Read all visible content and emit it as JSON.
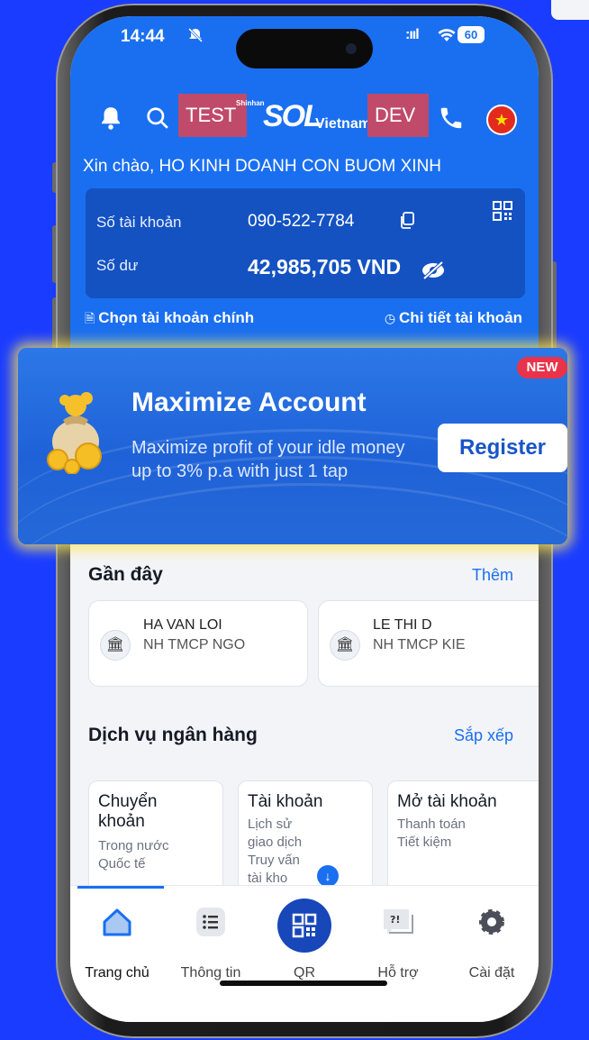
{
  "status_bar": {
    "time": "14:44",
    "signal": ":ııl",
    "battery": "60"
  },
  "header": {
    "test_tag": "TEST",
    "logo_small": "Shinhan",
    "logo_main": "SOL",
    "logo_country": "Vietnam",
    "dev_tag": "DEV"
  },
  "greeting": "Xin chào, HO KINH DOANH CON BUOM XINH",
  "account": {
    "number_label": "Số tài khoản",
    "number": "090-522-7784",
    "balance_label": "Số dư",
    "balance": "42,985,705  VND"
  },
  "account_links": {
    "choose_main": "Chọn tài khoản chính",
    "details": "Chi tiết tài khoản"
  },
  "promo": {
    "badge": "NEW",
    "title": "Maximize Account",
    "description": "Maximize profit of your idle money up to 3% p.a with just 1 tap",
    "button": "Register"
  },
  "recent": {
    "title": "Gần đây",
    "more": "Thêm",
    "items": [
      {
        "name": "HA VAN LOI",
        "bank": "NH TMCP NGO"
      },
      {
        "name": "LE THI D",
        "bank": "NH TMCP KIE"
      }
    ]
  },
  "services": {
    "title": "Dịch vụ ngân hàng",
    "sort": "Sắp xếp",
    "items": [
      {
        "title_line1": "Chuyển",
        "title_line2": "khoản",
        "subs": [
          "Trong nước",
          "Quốc tế"
        ]
      },
      {
        "title_line1": "Tài khoản",
        "title_line2": "",
        "subs": [
          "Lịch sử",
          "giao dịch",
          "Truy vấn",
          "tài kho"
        ]
      },
      {
        "title_line1": "Mở tài khoản",
        "title_line2": "",
        "subs": [
          "Thanh toán",
          "Tiết kiệm"
        ]
      }
    ]
  },
  "tabbar": {
    "items": [
      {
        "label": "Trang chủ",
        "icon": "home-icon"
      },
      {
        "label": "Thông tin",
        "icon": "list-icon"
      },
      {
        "label": "QR",
        "icon": "qr-icon"
      },
      {
        "label": "Hỗ trợ",
        "icon": "support-icon"
      },
      {
        "label": "Cài đặt",
        "icon": "settings-icon"
      }
    ]
  },
  "colors": {
    "background": "#1a3cff",
    "primary": "#1a6ff0",
    "account_card": "#1452c2",
    "tag": "#c04a6a",
    "new_badge": "#e9334b"
  }
}
